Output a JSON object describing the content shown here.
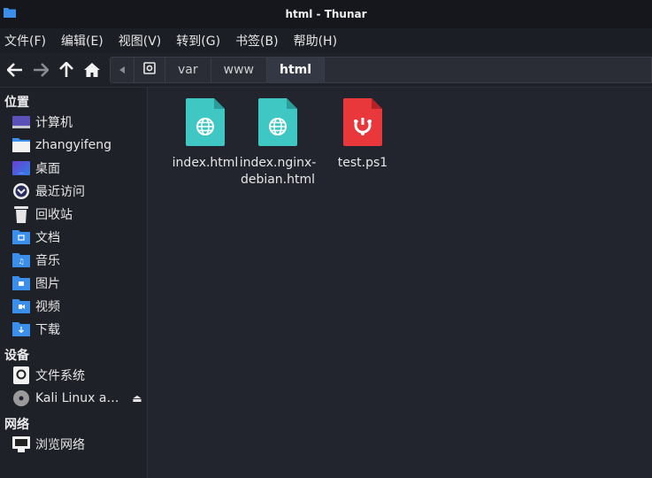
{
  "window": {
    "title": "html - Thunar"
  },
  "menu": [
    "文件(F)",
    "编辑(E)",
    "视图(V)",
    "转到(G)",
    "书签(B)",
    "帮助(H)"
  ],
  "toolbar": {
    "icons": [
      "back-arrow-icon",
      "forward-arrow-icon",
      "up-arrow-icon",
      "home-icon"
    ]
  },
  "path": {
    "segments": [
      "var",
      "www",
      "html"
    ],
    "active": "html"
  },
  "sidebar": {
    "places_title": "位置",
    "places": [
      {
        "label": "计算机",
        "icon": "computer-icon"
      },
      {
        "label": "zhangyifeng",
        "icon": "home-folder-icon"
      },
      {
        "label": "桌面",
        "icon": "desktop-icon"
      },
      {
        "label": "最近访问",
        "icon": "recent-icon"
      },
      {
        "label": "回收站",
        "icon": "trash-icon"
      },
      {
        "label": "文档",
        "icon": "documents-folder-icon"
      },
      {
        "label": "音乐",
        "icon": "music-folder-icon"
      },
      {
        "label": "图片",
        "icon": "pictures-folder-icon"
      },
      {
        "label": "视频",
        "icon": "videos-folder-icon"
      },
      {
        "label": "下载",
        "icon": "downloads-folder-icon"
      }
    ],
    "devices_title": "设备",
    "devices": [
      {
        "label": "文件系统",
        "icon": "filesystem-drive-icon"
      },
      {
        "label": "Kali Linux am…",
        "icon": "optical-disc-icon"
      }
    ],
    "network_title": "网络",
    "network": [
      {
        "label": "浏览网络",
        "icon": "network-icon"
      }
    ]
  },
  "files": [
    {
      "label": "index.html",
      "icon": "html-file-icon",
      "color": "#3fc7c3"
    },
    {
      "label": "index.nginx-debian.html",
      "label_lines": [
        "index.nginx-",
        "debian.html"
      ],
      "icon": "html-file-icon",
      "color": "#3fc7c3"
    },
    {
      "label": "test.ps1",
      "icon": "powershell-script-icon",
      "color": "#e8383b"
    }
  ]
}
